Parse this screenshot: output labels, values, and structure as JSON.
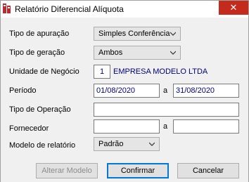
{
  "window": {
    "title": "Relatório Diferencial Alíquota",
    "close_glyph": "✕"
  },
  "form": {
    "tipo_apuracao": {
      "label": "Tipo de apuração",
      "value": "Simples Conferência"
    },
    "tipo_geracao": {
      "label": "Tipo de geração",
      "value": "Ambos"
    },
    "unidade_negocio": {
      "label": "Unidade de Negócio",
      "code": "1",
      "name": "EMPRESA MODELO LTDA"
    },
    "periodo": {
      "label": "Período",
      "from": "01/08/2020",
      "separator": "a",
      "to": "31/08/2020"
    },
    "tipo_operacao": {
      "label": "Tipo de Operação",
      "value": ""
    },
    "fornecedor": {
      "label": "Fornecedor",
      "from": "",
      "separator": "a",
      "to": ""
    },
    "modelo_relatorio": {
      "label": "Modelo de relatório",
      "value": "Padrão"
    }
  },
  "buttons": {
    "alterar_modelo": "Alterar Modelo",
    "confirmar": "Confirmar",
    "cancelar": "Cancelar"
  }
}
